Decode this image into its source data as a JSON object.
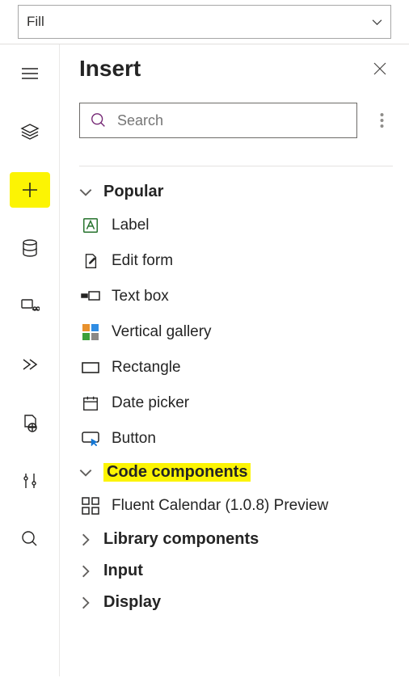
{
  "propbar": {
    "value": "Fill"
  },
  "panel": {
    "title": "Insert",
    "search_placeholder": "Search"
  },
  "groups": {
    "popular": {
      "label": "Popular",
      "expanded": true,
      "items": [
        {
          "icon": "label",
          "label": "Label"
        },
        {
          "icon": "editform",
          "label": "Edit form"
        },
        {
          "icon": "textbox",
          "label": "Text box"
        },
        {
          "icon": "gallery",
          "label": "Vertical gallery"
        },
        {
          "icon": "rectangle",
          "label": "Rectangle"
        },
        {
          "icon": "datepicker",
          "label": "Date picker"
        },
        {
          "icon": "button",
          "label": "Button"
        }
      ]
    },
    "code": {
      "label": "Code components",
      "expanded": true,
      "items": [
        {
          "icon": "grid",
          "label": "Fluent Calendar (1.0.8) Preview"
        }
      ]
    },
    "library": {
      "label": "Library components",
      "expanded": false
    },
    "input": {
      "label": "Input",
      "expanded": false
    },
    "display": {
      "label": "Display",
      "expanded": false
    }
  },
  "rail": {
    "highlighted": "insert"
  },
  "highlight_color": "#fcf403"
}
